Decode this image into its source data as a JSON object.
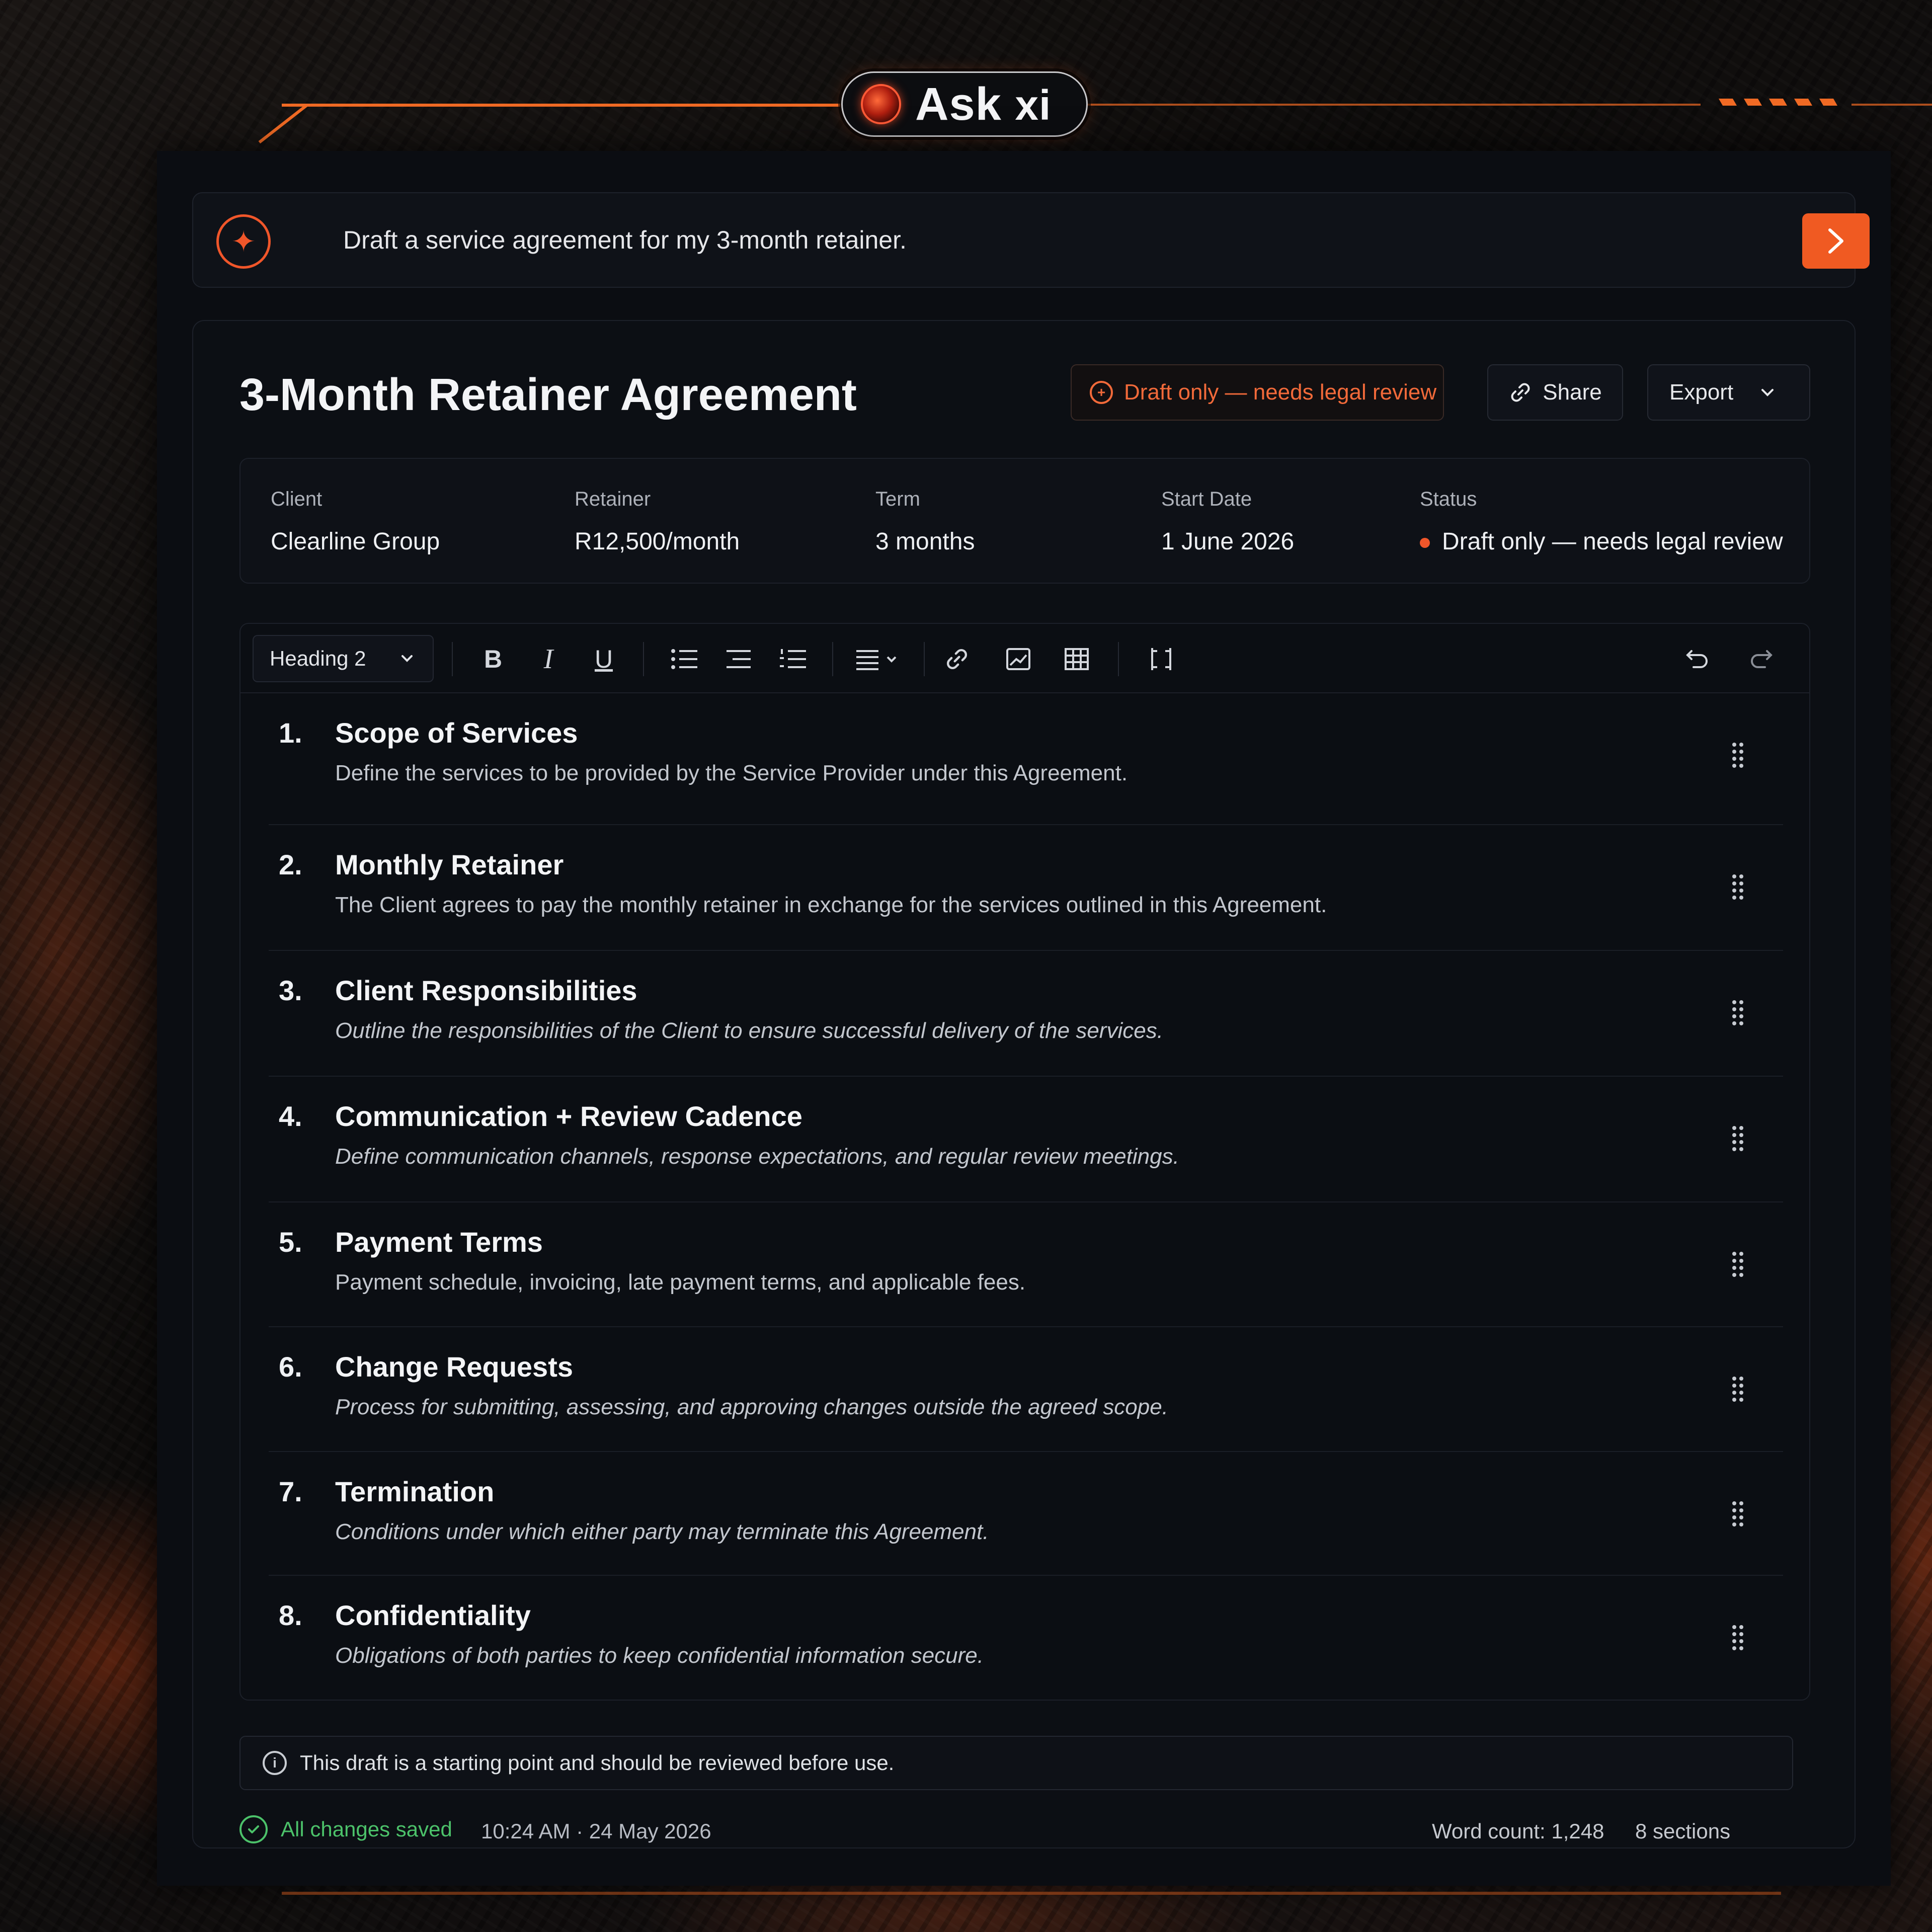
{
  "brand": {
    "name": "Ask",
    "suffix": "xi"
  },
  "prompt": {
    "text": "Draft a service agreement for my 3-month retainer."
  },
  "document": {
    "title": "3-Month Retainer Agreement",
    "review_badge": "Draft only — needs legal review",
    "share_label": "Share",
    "export_label": "Export"
  },
  "meta": {
    "client_label": "Client",
    "client_value": "Clearline Group",
    "retainer_label": "Retainer",
    "retainer_value": "R12,500/month",
    "term_label": "Term",
    "term_value": "3 months",
    "start_label": "Start Date",
    "start_value": "1 June 2026",
    "status_label": "Status",
    "status_value": "Draft only — needs legal review"
  },
  "toolbar": {
    "heading_style": "Heading 2",
    "tools": [
      "bold-icon",
      "italic-icon",
      "underline-icon",
      "bullet-list-icon",
      "indent-list-icon",
      "numbered-list-icon",
      "align-icon",
      "link-icon",
      "image-icon",
      "table-icon",
      "page-break-icon",
      "undo-icon",
      "redo-icon"
    ]
  },
  "sections": [
    {
      "num": "1.",
      "title": "Scope of Services",
      "desc": "Define the services to be provided by the Service Provider under this Agreement."
    },
    {
      "num": "2.",
      "title": "Monthly Retainer",
      "desc": "The Client agrees to pay the monthly retainer in exchange for the services outlined in this Agreement."
    },
    {
      "num": "3.",
      "title": "Client Responsibilities",
      "desc": "Outline the responsibilities of the Client to ensure successful delivery of the services."
    },
    {
      "num": "4.",
      "title": "Communication + Review Cadence",
      "desc": "Define communication channels, response expectations, and regular review meetings."
    },
    {
      "num": "5.",
      "title": "Payment Terms",
      "desc": "Payment schedule, invoicing, late payment terms, and applicable fees."
    },
    {
      "num": "6.",
      "title": "Change Requests",
      "desc": "Process for submitting, assessing, and approving changes outside the agreed scope."
    },
    {
      "num": "7.",
      "title": "Termination",
      "desc": "Conditions under which either party may terminate this Agreement."
    },
    {
      "num": "8.",
      "title": "Confidentiality",
      "desc": "Obligations of both parties to keep confidential information secure."
    }
  ],
  "notice": {
    "text": "This draft is a starting point and should be reviewed before use."
  },
  "footer": {
    "saved_label": "All changes saved",
    "saved_time": "10:24 AM · 24 May 2026",
    "word_count": "Word count: 1,248",
    "sections_count": "8 sections"
  },
  "colors": {
    "accent": "#f05a22",
    "saved": "#4cc26a",
    "background": "#0b0d12"
  }
}
